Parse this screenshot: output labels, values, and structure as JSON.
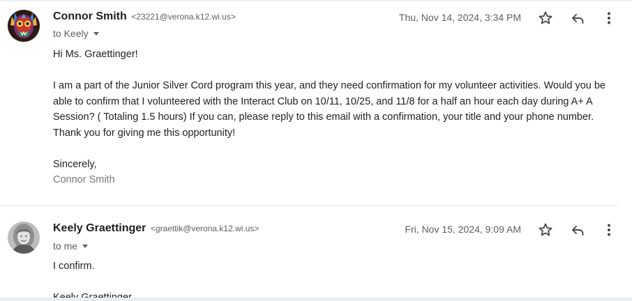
{
  "thread": {
    "messages": [
      {
        "sender_name": "Connor Smith",
        "sender_email": "<23221@verona.k12.wi.us>",
        "recipient": "to Keely",
        "timestamp": "Thu, Nov 14, 2024, 3:34 PM",
        "body": {
          "greeting": "Hi Ms. Graettinger!",
          "paragraph": "I am a part of the Junior Silver Cord program this year, and they need confirmation for my volunteer activities. Would you be able to confirm that I volunteered with the Interact Club on 10/11, 10/25, and 11/8 for a half an hour each day during A+ A Session? ( Totaling 1.5 hours) If you can, please reply to this email with a confirmation, your title and your phone number. Thank you for giving me this opportunity!",
          "closing": "Sincerely,",
          "signature": "Connor Smith"
        },
        "avatar_icon": "colorful-mask-avatar"
      },
      {
        "sender_name": "Keely Graettinger",
        "sender_email": "<graettik@verona.k12.wi.us>",
        "recipient": "to me",
        "timestamp": "Fri, Nov 15, 2024, 9:09 AM",
        "body": {
          "text": "I confirm.",
          "signature": "Keely Graettinger"
        },
        "avatar_icon": "photo-avatar"
      }
    ]
  },
  "icons": {
    "star": "star-icon",
    "reply": "reply-icon",
    "more": "more-vert-icon"
  },
  "colors": {
    "text_primary": "#1f1f1f",
    "text_secondary": "#5e5e5e",
    "signature": "#777777",
    "divider": "#e3e3e3"
  }
}
